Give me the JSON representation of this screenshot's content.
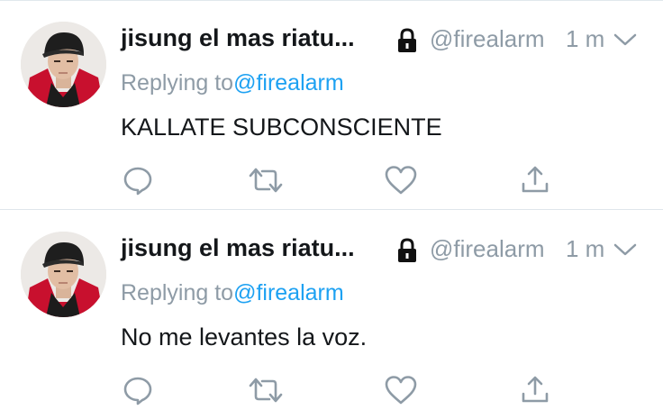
{
  "colors": {
    "icon_gray": "#8e9ba6",
    "link_blue": "#1da1f2",
    "text_dark": "#14171a",
    "divider": "#e1e8ed"
  },
  "tweets": [
    {
      "display_name": "jisung el mas riatu...",
      "handle": "@firealarm",
      "timestamp": "1 m",
      "reply_prefix": "Replying to",
      "reply_handle": "@firealarm",
      "text": "KALLATE SUBCONSCIENTE",
      "icons": [
        "avatar",
        "lock-icon",
        "chevron-down-icon",
        "reply-icon",
        "retweet-icon",
        "like-icon",
        "share-icon"
      ]
    },
    {
      "display_name": "jisung el mas riatu...",
      "handle": "@firealarm",
      "timestamp": "1 m",
      "reply_prefix": "Replying to",
      "reply_handle": "@firealarm",
      "text": "No me levantes la voz.",
      "icons": [
        "avatar",
        "lock-icon",
        "chevron-down-icon",
        "reply-icon",
        "retweet-icon",
        "like-icon",
        "share-icon"
      ]
    }
  ]
}
